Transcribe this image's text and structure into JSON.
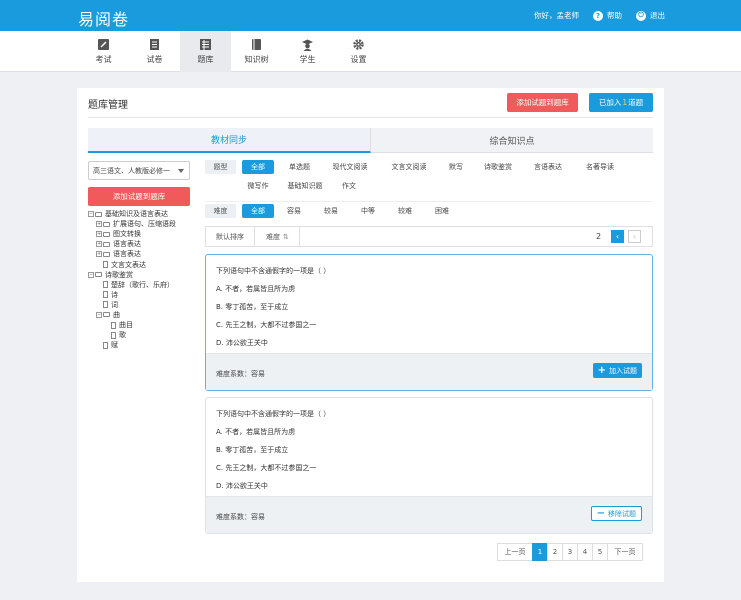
{
  "app": {
    "logo": "易阅卷"
  },
  "user": {
    "greeting": "你好，孟老师",
    "help": "帮助",
    "logout": "退出"
  },
  "nav": [
    {
      "label": "考试",
      "icon": "edit-icon"
    },
    {
      "label": "试卷",
      "icon": "paper-icon"
    },
    {
      "label": "题库",
      "icon": "question-bank-icon",
      "active": true
    },
    {
      "label": "知识树",
      "icon": "book-icon"
    },
    {
      "label": "学生",
      "icon": "student-icon"
    },
    {
      "label": "设置",
      "icon": "gear-icon"
    }
  ],
  "panel": {
    "title": "题库管理",
    "add_to_bank": "添加试题到题库",
    "joined_prefix": "已加入",
    "joined_count": "1",
    "joined_suffix": "道题"
  },
  "tabs": [
    {
      "label": "教材同步",
      "active": true
    },
    {
      "label": "综合知识点",
      "active": false
    }
  ],
  "sidebar": {
    "select_value": "高三语文、人教版必修一",
    "add_button": "添加试题到题库",
    "tree": [
      {
        "label": "基础知识及语言表达",
        "level": 0,
        "toggle": "−",
        "type": "folder"
      },
      {
        "label": "扩展语句、压缩语段",
        "level": 1,
        "toggle": "+",
        "type": "folder"
      },
      {
        "label": "图文转换",
        "level": 1,
        "toggle": "+",
        "type": "folder"
      },
      {
        "label": "语言表达",
        "level": 1,
        "toggle": "+",
        "type": "folder"
      },
      {
        "label": "语言表达",
        "level": 1,
        "toggle": "+",
        "type": "folder"
      },
      {
        "label": "文言文表达",
        "level": 1,
        "toggle": "",
        "type": "file"
      },
      {
        "label": "诗歌鉴赏",
        "level": 0,
        "toggle": "−",
        "type": "folder"
      },
      {
        "label": "楚辞（歌行、乐府）",
        "level": 1,
        "toggle": "",
        "type": "file"
      },
      {
        "label": "诗",
        "level": 1,
        "toggle": "",
        "type": "file"
      },
      {
        "label": "词",
        "level": 1,
        "toggle": "",
        "type": "file"
      },
      {
        "label": "曲",
        "level": 1,
        "toggle": "−",
        "type": "folder"
      },
      {
        "label": "曲目",
        "level": 2,
        "toggle": "",
        "type": "file"
      },
      {
        "label": "歌",
        "level": 2,
        "toggle": "",
        "type": "file"
      },
      {
        "label": "赋",
        "level": 1,
        "toggle": "",
        "type": "file"
      }
    ]
  },
  "filters": {
    "type_label": "题型",
    "types_row1": [
      "全部",
      "单选题",
      "现代文阅读",
      "文言文阅读",
      "默写",
      "诗歌鉴赏",
      "言语表达",
      "名著导读"
    ],
    "types_row2": [
      "微写作",
      "基础知识题",
      "作文"
    ],
    "difficulty_label": "难度",
    "difficulties": [
      "全部",
      "容易",
      "较易",
      "中等",
      "较难",
      "困难"
    ]
  },
  "sort": {
    "default": "默认排序",
    "difficulty": "难度",
    "sort_icon": "sort-icon",
    "page": "2",
    "prev": "‹",
    "next": "›"
  },
  "questions": [
    {
      "stem": "下列语句中不含通假字的一项是（   ）",
      "options": [
        "A. 不者，若属皆且所为虏",
        "B. 零丁孤苦，至于成立",
        "C. 先王之制，大都不过参国之一",
        "D. 沛公欲王关中"
      ],
      "difficulty": "难度系数：容易",
      "action": "加入试题",
      "action_type": "add"
    },
    {
      "stem": "下列语句中不含通假字的一项是（   ）",
      "options": [
        "A. 不者，若属皆且所为虏",
        "B. 零丁孤苦，至于成立",
        "C. 先王之制，大都不过参国之一",
        "D. 沛公欲王关中"
      ],
      "difficulty": "难度系数：容易",
      "action": "移除试题",
      "action_type": "remove"
    }
  ],
  "pager": {
    "prev": "上一页",
    "pages": [
      "1",
      "2",
      "3",
      "4",
      "5"
    ],
    "current": "1",
    "next": "下一页"
  },
  "colors": {
    "primary": "#1a9bde",
    "danger": "#f15a5a"
  }
}
